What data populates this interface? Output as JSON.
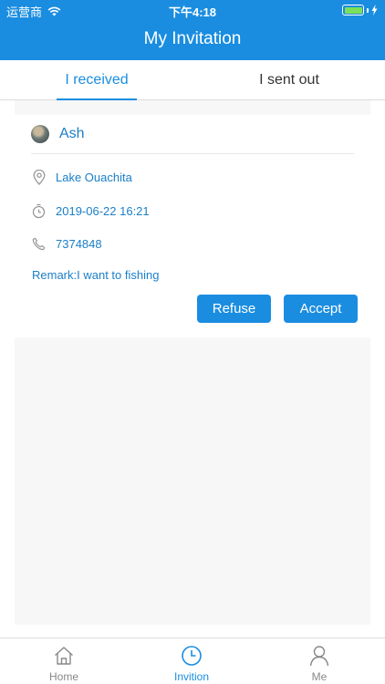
{
  "status_bar": {
    "carrier": "运营商",
    "time": "下午4:18",
    "battery_level": 1.0
  },
  "nav": {
    "title": "My Invitation"
  },
  "tabs": [
    {
      "label": "I received",
      "active": true
    },
    {
      "label": "I sent out",
      "active": false
    }
  ],
  "invitation": {
    "user_name": "Ash",
    "location": "Lake Ouachita",
    "datetime": "2019-06-22 16:21",
    "phone": "7374848",
    "remark": "Remark:I want to fishing",
    "refuse_label": "Refuse",
    "accept_label": "Accept"
  },
  "bottom_tabs": [
    {
      "label": "Home",
      "icon": "home-icon",
      "active": false
    },
    {
      "label": "Invition",
      "icon": "clock-icon",
      "active": true
    },
    {
      "label": "Me",
      "icon": "person-icon",
      "active": false
    }
  ],
  "colors": {
    "primary": "#1a8de0",
    "text_accent": "#1a7fc8",
    "inactive": "#888888",
    "background": "#f7f7f7"
  }
}
